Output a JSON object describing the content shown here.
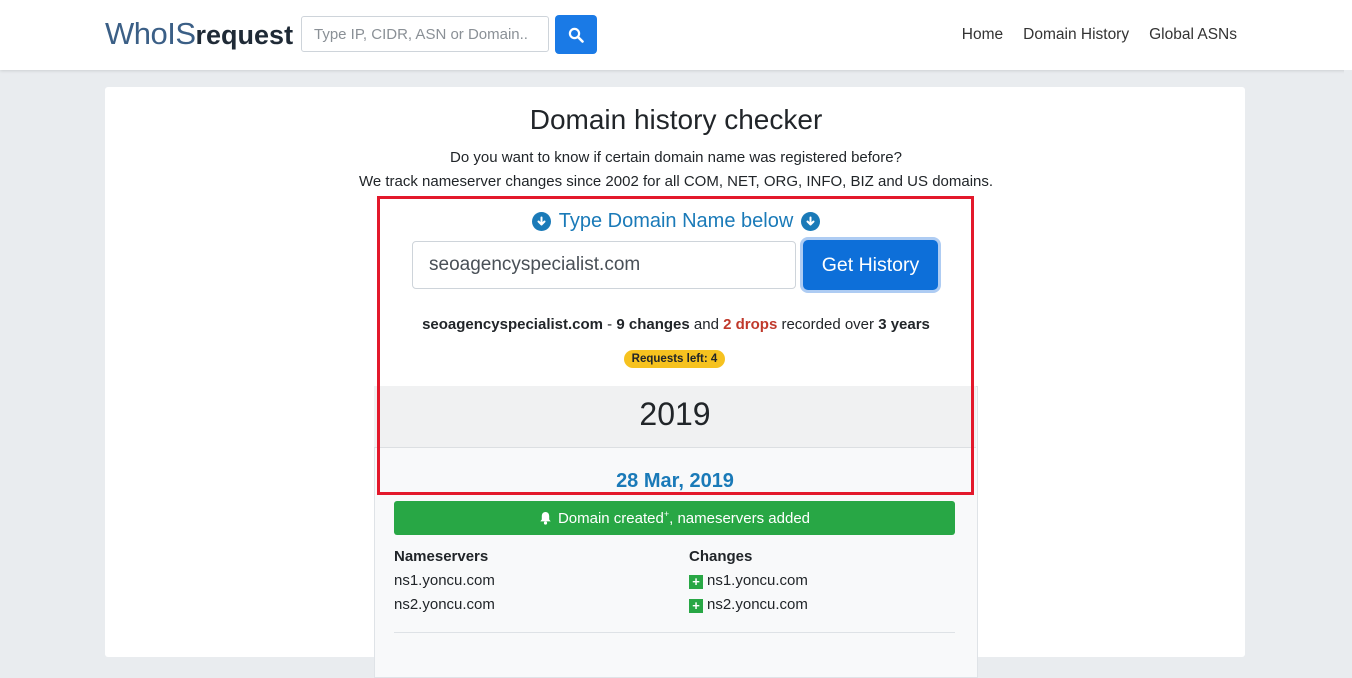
{
  "brand": {
    "part1": "WhoIS",
    "part2": "request"
  },
  "search": {
    "placeholder": "Type IP, CIDR, ASN or Domain.."
  },
  "nav": {
    "items": [
      "Home",
      "Domain History",
      "Global ASNs"
    ]
  },
  "page": {
    "title": "Domain history checker",
    "subtitle1": "Do you want to know if certain domain name was registered before?",
    "subtitle2": "We track nameserver changes since 2002 for all COM, NET, ORG, INFO, BIZ and US domains."
  },
  "form": {
    "heading": "Type Domain Name below",
    "domain_value": "seoagencyspecialist.com",
    "button_label": "Get History"
  },
  "summary": {
    "domain": "seoagencyspecialist.com",
    "sep": " - ",
    "changes": "9 changes",
    "and": " and ",
    "drops": "2 drops",
    "recorded": " recorded over ",
    "years": "3 years"
  },
  "badge": "Requests left: 4",
  "history": {
    "year": "2019",
    "date": "28 Mar, 2019",
    "event_text": "Domain created",
    "event_sup": "+",
    "event_suffix": ", nameservers added",
    "nameservers_header": "Nameservers",
    "changes_header": "Changes",
    "nameservers": [
      "ns1.yoncu.com",
      "ns2.yoncu.com"
    ],
    "changes": [
      "ns1.yoncu.com",
      "ns2.yoncu.com"
    ]
  },
  "colors": {
    "primary": "#0d6fd9",
    "accent_blue": "#1a7ab8",
    "success": "#28a745",
    "danger": "#c0392b",
    "highlight": "#e3182b",
    "badge": "#f6c21f"
  }
}
